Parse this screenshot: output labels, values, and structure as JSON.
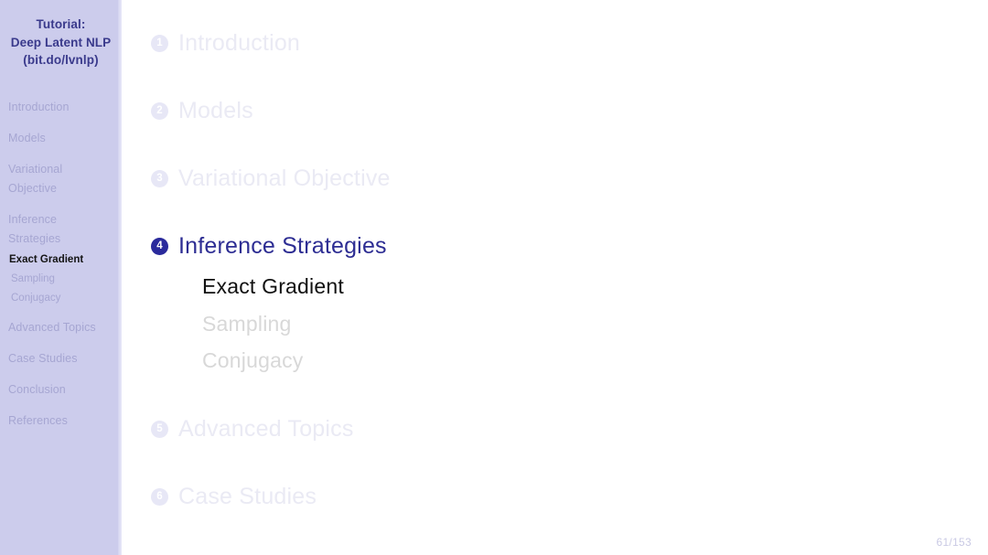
{
  "sidebar": {
    "title_lines": [
      "Tutorial:",
      "Deep Latent NLP",
      "(bit.do/lvnlp)"
    ],
    "nav": [
      {
        "label": "Introduction",
        "lines": [
          "Introduction"
        ],
        "active": false
      },
      {
        "label": "Models",
        "lines": [
          "Models"
        ],
        "active": false
      },
      {
        "label": "Variational Objective",
        "lines": [
          "Variational",
          "Objective"
        ],
        "active": false
      },
      {
        "label": "Inference Strategies",
        "lines": [
          "Inference",
          "Strategies"
        ],
        "active": false
      },
      {
        "label": "Advanced Topics",
        "lines": [
          "Advanced Topics"
        ],
        "active": false
      },
      {
        "label": "Case Studies",
        "lines": [
          "Case Studies"
        ],
        "active": false
      },
      {
        "label": "Conclusion",
        "lines": [
          "Conclusion"
        ],
        "active": false
      },
      {
        "label": "References",
        "lines": [
          "References"
        ],
        "active": false
      }
    ],
    "subnav": [
      {
        "label": "Exact Gradient",
        "active": true
      },
      {
        "label": "Sampling",
        "active": false
      },
      {
        "label": "Conjugacy",
        "active": false
      }
    ]
  },
  "main": {
    "toc": [
      {
        "number": "1",
        "label": "Introduction",
        "current": false
      },
      {
        "number": "2",
        "label": "Models",
        "current": false
      },
      {
        "number": "3",
        "label": "Variational Objective",
        "current": false
      },
      {
        "number": "4",
        "label": "Inference Strategies",
        "current": true
      },
      {
        "number": "5",
        "label": "Advanced Topics",
        "current": false
      },
      {
        "number": "6",
        "label": "Case Studies",
        "current": false
      }
    ],
    "subsections": [
      {
        "label": "Exact Gradient",
        "active": true
      },
      {
        "label": "Sampling",
        "active": false
      },
      {
        "label": "Conjugacy",
        "active": false
      }
    ]
  },
  "footer": {
    "page_number": "61/153"
  },
  "colors": {
    "sidebar_bg": "#ccccec",
    "title_text": "#3a3a8c",
    "nav_muted": "#a6a6d2",
    "accent_blue": "#2a2a9c",
    "toc_muted": "#eaeaf4",
    "sub_muted": "#d8d8d8",
    "active_text": "#111111"
  }
}
